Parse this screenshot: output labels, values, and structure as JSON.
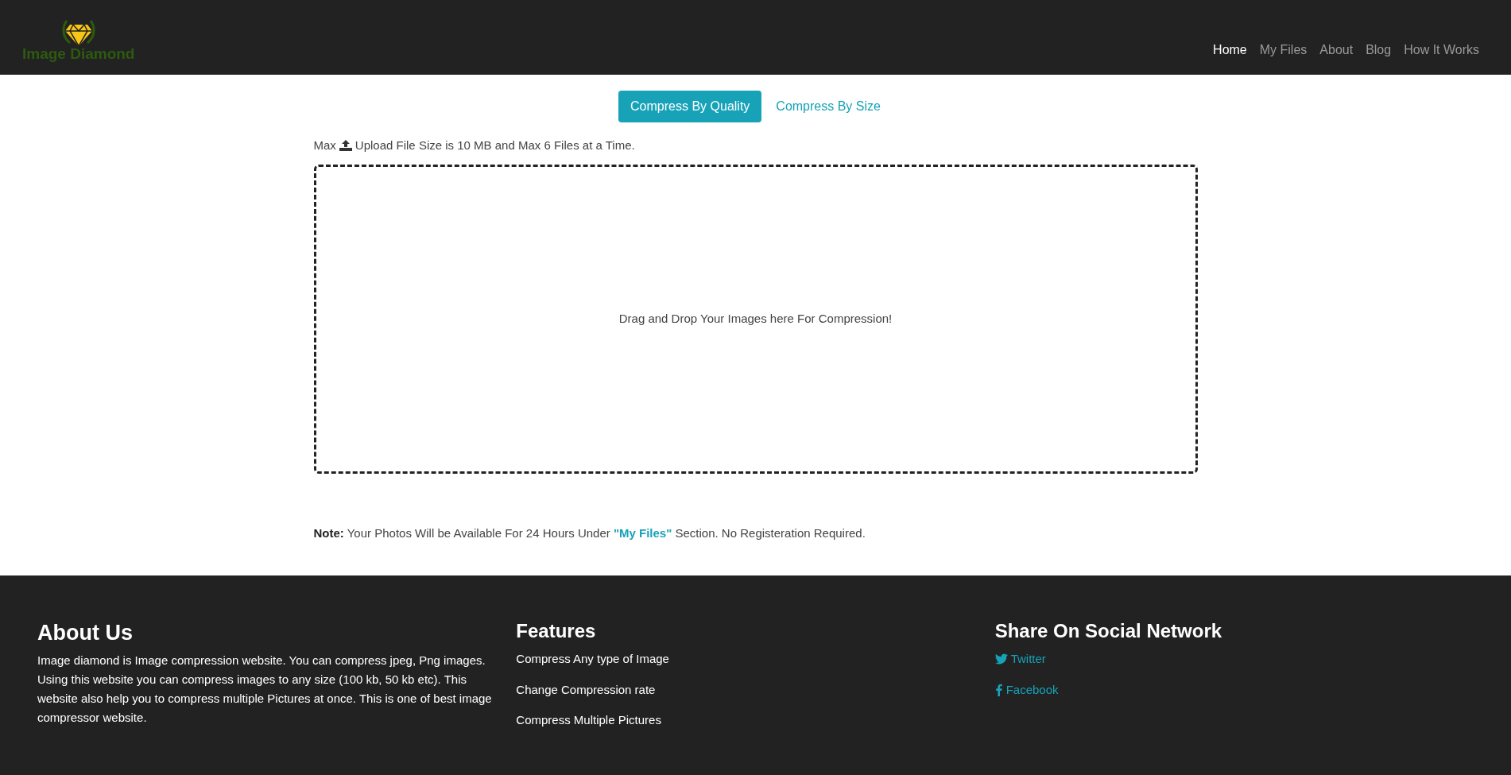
{
  "navbar": {
    "logo_text": "Image Diamond",
    "links": [
      {
        "label": "Home",
        "selected": true
      },
      {
        "label": "My Files",
        "selected": false
      },
      {
        "label": "About",
        "selected": false
      },
      {
        "label": "Blog",
        "selected": false
      },
      {
        "label": "How It Works",
        "selected": false
      }
    ]
  },
  "tabs": [
    {
      "label": "Compress By Quality",
      "selected": true
    },
    {
      "label": "Compress By Size",
      "selected": false
    }
  ],
  "upload_limit": {
    "before_icon": "Max",
    "after_icon": "Upload File Size is 10 MB and Max 6 Files at a Time."
  },
  "dropzone": {
    "text": "Drag and Drop Your Images here For Compression!"
  },
  "note": {
    "label": "Note:",
    "text_before": "Your Photos Will be Available For 24 Hours Under",
    "link": "\"My Files\"",
    "text_after": "Section. No Registeration Required."
  },
  "footer": {
    "about": {
      "title": "About Us",
      "text": "Image diamond is Image compression website. You can compress jpeg, Png images. Using this website you can compress images to any size (100 kb, 50 kb etc). This website also help you to compress multiple Pictures at once. This is one of best image compressor website."
    },
    "features": {
      "title": "Features",
      "items": [
        "Compress Any type of Image",
        "Change Compression rate",
        "Compress Multiple Pictures"
      ]
    },
    "social": {
      "title": "Share On Social Network",
      "links": [
        {
          "kind": "twitter",
          "label": "Twitter"
        },
        {
          "kind": "facebook",
          "label": "Facebook"
        }
      ]
    }
  }
}
